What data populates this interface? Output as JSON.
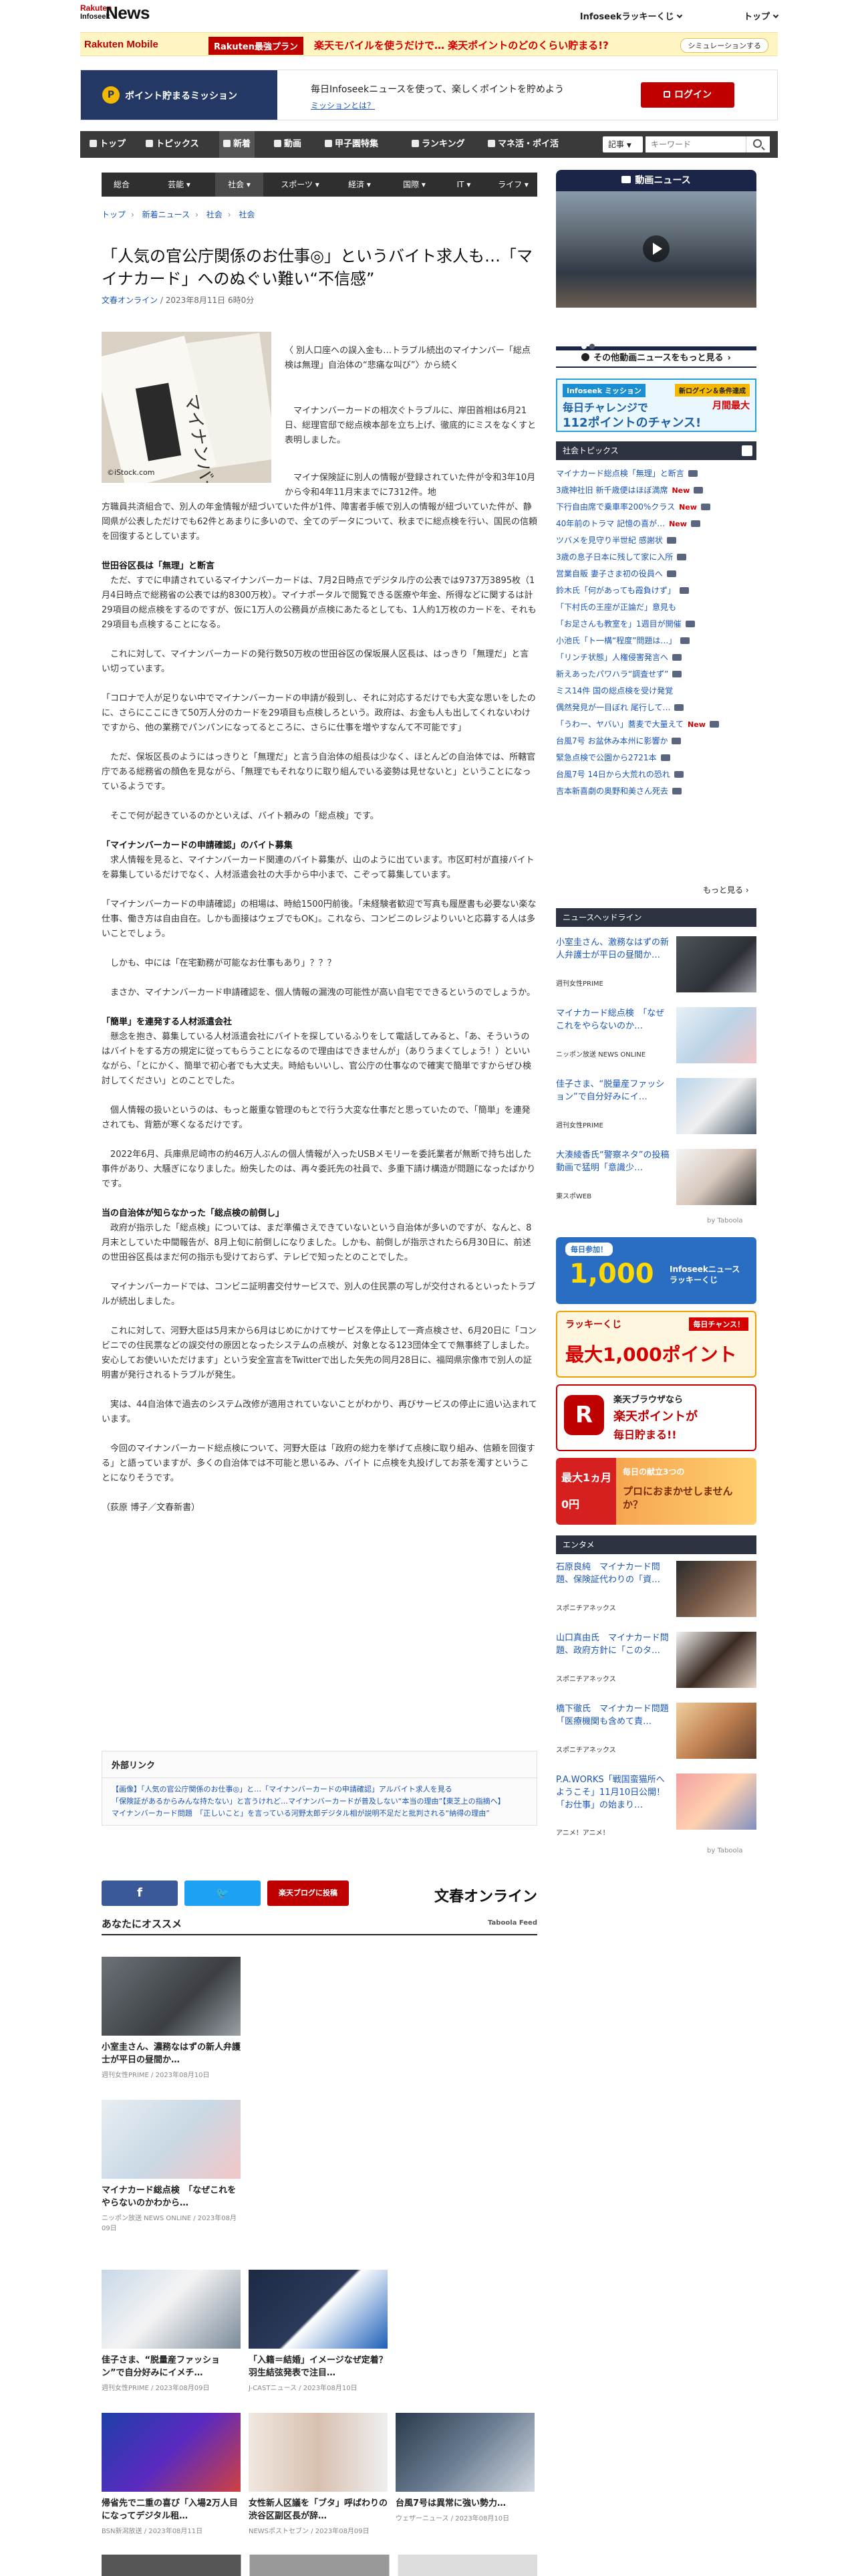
{
  "header": {
    "logo_top": "Rakuten",
    "logo_sub": "Infoseek",
    "logo_main": "News",
    "lucky": "Infoseekラッキーくじ",
    "top": "トップ"
  },
  "promo": {
    "mobile": "Rakuten Mobile",
    "plan": "Rakuten最強プラン",
    "text": "楽天モバイルを使うだけで… 楽天ポイントのどのくらい貯まる!?",
    "button": "シミュレーションする"
  },
  "mission": {
    "left_label": "ポイント貯まるミッション",
    "text": "毎日Infoseekニュースを使って、楽しくポイントを貯めよう",
    "link": "ミッションとは？",
    "login": "ログイン"
  },
  "nav": {
    "items": [
      "トップ",
      "トピックス",
      "新着",
      "動画",
      "甲子園特集",
      "ランキング",
      "マネ活・ポイ活"
    ],
    "search_select": "記事",
    "search_placeholder": "キーワード"
  },
  "subnav": [
    "総合",
    "芸能",
    "社会",
    "スポーツ",
    "経済",
    "国際",
    "IT",
    "ライフ"
  ],
  "breadcrumb": [
    "トップ",
    "新着ニュース",
    "社会",
    "社会"
  ],
  "article": {
    "title": "「人気の官公庁関係のお仕事◎」というバイト求人も…「マイナカード」へのぬぐい難い“不信感”",
    "source": "文春オンライン",
    "date": " / 2023年8月11日 6時0分",
    "photo_credit": "©iStock.com",
    "photo_text": "マイナンバー",
    "lead": "〈 別人口座への誤入金も…トラブル続出のマイナンバー「総点検は無理」自治体の“悲痛な叫び”〉から続く",
    "p1": "マイナンバーカードの相次ぐトラブルに、岸田首相は6月21日、総理官邸で総点検本部を立ち上げ、徹底的にミスをなくすと表明しました。",
    "p2a": "マイナ保険証に別人の情報が登録されていた件が令和3年10月から令和4年11月末までに7312件。地",
    "p2b": "方職員共済組合で、別人の年金情報が紐づいていた件が1件、障害者手帳で別人の情報が紐づいていた件が、静岡県が公表しただけでも62件とあまりに多いので、全てのデータについて、秋までに総点検を行い、国民の信頼を回復するとしています。",
    "h1": "世田谷区長は「無理」と断言",
    "p3": "ただ、すでに申請されているマイナンバーカードは、7月2日時点でデジタル庁の公表では9737万3895枚（1月4日時点で総務省の公表では約8300万枚）。マイナポータルで閲覧できる医療や年金、所得などに関するは計29項目の総点検をするのですが、仮に1万人の公務員が点検にあたるとしても、1人約1万枚のカードを、それも29項目も点検することになる。",
    "p4": "これに対して、マイナンバーカードの発行数50万枚の世田谷区の保坂展人区長は、はっきり「無理だ」と言い切っています。",
    "p5": "「コロナで人が足りない中でマイナンバーカードの申請が殺到し、それに対応するだけでも大変な思いをしたのに、さらにここにきて50万人分のカードを29項目も点検しろという。政府は、お金も人も出してくれないわけですから、他の業務でパンパンになってるところに、さらに仕事を増やすなんて不可能です」",
    "p6": "ただ、保坂区長のようにはっきりと「無理だ」と言う自治体の組長は少なく、ほとんどの自治体では、所轄官庁である総務省の顔色を見ながら、「無理でもそれなりに取り組んでいる姿勢は見せないと」ということになっているようです。",
    "p7": "そこで何が起きているのかといえば、バイト頼みの「総点検」です。",
    "h2": "「マイナンバーカードの申請確認」のバイト募集",
    "p8": "求人情報を見ると、マイナンバーカード関連のバイト募集が、山のように出ています。市区町村が直接バイトを募集しているだけでなく、人材派遣会社の大手から中小まで、こぞって募集しています。",
    "p9": "「マイナンバーカードの申請確認」の相場は、時給1500円前後。「未経験者歓迎で写真も履歴書も必要ない楽な仕事、働き方は自由自在。しかも面接はウェブでもOK」。これなら、コンビニのレジよりいいと応募する人は多いことでしょう。",
    "p10": "しかも、中には「在宅勤務が可能なお仕事もあり」？？？",
    "p11": "まさか、マイナンバーカード申請確認を、個人情報の漏洩の可能性が高い自宅でできるというのでしょうか。",
    "h3": "「簡単」を連発する人材派遣会社",
    "p12": "懸念を抱き、募集している人材派遣会社にバイトを探しているふりをして電話してみると、「あ、そういうのはバイトをする方の規定に従ってもらうことになるので理由はできませんが」（ありうまくてしょう！）といいながら、「とにかく、簡単で初心者でも大丈夫。時給もいいし、官公庁の仕事なので確実で簡単ですからぜひ検討してください」とのことでした。",
    "p13": "個人情報の扱いというのは、もっと厳重な管理のもとで行う大変な仕事だと思っていたので、「簡単」を連発されても、背筋が寒くなるだけです。",
    "p14": "2022年6月、兵庫県尼崎市の約46万人ぶんの個人情報が入ったUSBメモリーを委託業者が無断で持ち出した事件があり、大騒ぎになりました。紛失したのは、再々委託先の社員で、多重下請け構造が問題になったばかりです。",
    "h4": "当の自治体が知らなかった「総点検の前倒し」",
    "p15": "政府が指示した「総点検」については、まだ準備さえできていないという自治体が多いのですが、なんと、8月末としていた中間報告が、8月上旬に前倒しになりました。しかも、前倒しが指示されたら6月30日に、前述の世田谷区長はまだ何の指示も受けておらず、テレビで知ったとのことでした。",
    "p16": "マイナンバーカードでは、コンビニ証明書交付サービスで、別人の住民票の写しが交付されるといったトラブルが続出しました。",
    "p17": "これに対して、河野大臣は5月末から6月はじめにかけてサービスを停止して一斉点検させ、6月20日に「コンビニでの住民票などの誤交付の原因となったシステムの点検が、対象となる123団体全てで無事終了しました。安心してお使いいただけます」という安全宣言をTwitterで出した矢先の同月28日に、福岡県宗像市で別人の証明書が発行されるトラブルが発生。",
    "p18": "実は、44自治体で過去のシステム改修が適用されていないことがわかり、再びサービスの停止に追い込まれています。",
    "p19": "今回のマイナンバーカード総点検について、河野大臣は「政府の総力を挙げて点検に取り組み、信頼を回復する」と語っていますが、多くの自治体では不可能と思いるみ、バイト に点検を丸投げしてお茶を濁すということになりそうです。",
    "byline": "（荻原 博子／文春新書）"
  },
  "external": {
    "heading": "外部リンク",
    "links": [
      "【画像】「人気の官公庁関係のお仕事◎」と…「マイナンバーカードの申請確認」アルバイト求人を見る",
      "「保険証があるからみんな持たない」と言うけれど…マイナンバーカードが普及しない“本当の理由”【東芝上の指摘へ】",
      "マイナンバーカード問題　「正しいこと」を言っている河野太郎デジタル相が説明不足だと批判される“納得の理由”"
    ]
  },
  "share": {
    "rakuten_blog": "楽天ブログに投稿",
    "bunshun": "文春オンライン"
  },
  "recommend": {
    "title": "あなたにオススメ",
    "taboola": "Taboola Feed",
    "cards": [
      {
        "title": "小室圭さん、濃務なはずの新人弁護士が平日の昼間か…",
        "src": "週刊女性PRIME / 2023年08月10日"
      },
      {
        "title": "マイナカード総点検　「なぜこれをやらないのかわから…",
        "src": "ニッポン放送 NEWS ONLINE / 2023年08月09日"
      },
      {
        "title": "佳子さま、“脱量産ファッション”で自分好みにイメチ…",
        "src": "週刊女性PRIME / 2023年08月09日"
      },
      {
        "title": "「入籍＝結婚」イメージなぜ定着？羽生結弦発表で注目…",
        "src": "J-CASTニュース / 2023年08月10日"
      },
      {
        "title": "帰省先で二重の喜び「入場2万人目になってデジタル租…",
        "src": "BSN新潟放送 / 2023年08月11日"
      },
      {
        "title": "女性新人区議を「ブタ」呼ばわりの渋谷区副区長が辞…",
        "src": "NEWSポストセブン / 2023年08月09日"
      },
      {
        "title": "台風7号は異常に強い勢力…",
        "src": "ウェザーニュース / 2023年08月10日"
      }
    ]
  },
  "sidebar": {
    "video_title": "動画ニュース",
    "video_more": "その他動画ニュースをもっと見る",
    "mission_banner": {
      "brand": "Infoseek ミッション",
      "tag": "新ログイン＆条件達成",
      "line1": "毎日チャレンジで",
      "tag2": "月間最大",
      "line2": "112ポイントのチャンス!"
    },
    "topics_title": "社会トピックス",
    "topics": [
      {
        "t": "マイナカード総点検「無理」と断言",
        "new": ""
      },
      {
        "t": "3歳神社旧 新千歳便はほぼ満席",
        "new": "New"
      },
      {
        "t": "下行自由席で乗車率200%クラス",
        "new": "New"
      },
      {
        "t": "40年前のトラマ 記憶の喜が…",
        "new": "New"
      },
      {
        "t": "ツバメを見守り半世紀 感謝状",
        "new": ""
      },
      {
        "t": "3歳の息子日本に残して家に入所",
        "new": ""
      },
      {
        "t": "営業自販 妻子さま初の役員へ",
        "new": ""
      },
      {
        "t": "鈴木氏「何があっても霞負けず」",
        "new": ""
      },
      {
        "t": "「下村氏の王座が正論だ」意見も",
        "new": ""
      },
      {
        "t": "「お足さんも教室を」1週目が開催",
        "new": ""
      },
      {
        "t": "小池氏「ト一構“程度”問題は…」",
        "new": ""
      },
      {
        "t": "「リンチ状態」人権侵害発言へ",
        "new": ""
      },
      {
        "t": "新えあったパワハラ“調査せず”",
        "new": ""
      },
      {
        "t": "ミス14件 国の総点検を受け発覚",
        "new": ""
      },
      {
        "t": "偶然発見が一目ぼれ 尾行して…",
        "new": ""
      },
      {
        "t": "「うわー、ヤバい」蕎麦で大量えて",
        "new": "New"
      },
      {
        "t": "台風7号 お盆休み本州に影響か",
        "new": ""
      },
      {
        "t": "緊急点検で公園から2721本",
        "new": ""
      },
      {
        "t": "台風7号 14日から大荒れの恐れ",
        "new": ""
      },
      {
        "t": "吉本新喜劇の奥野和美さん死去",
        "new": ""
      }
    ],
    "more": "もっと見る",
    "headline_title": "ニュースヘッドライン",
    "headlines": [
      {
        "t": "小室圭さん、激務なはずの新人弁護士が平日の昼間か…",
        "s": "週刊女性PRIME"
      },
      {
        "t": "マイナカード総点検　「なぜこれをやらないのか…",
        "s": "ニッポン放送 NEWS ONLINE"
      },
      {
        "t": "佳子さま、“脱量産ファッション”で自分好みにイ…",
        "s": "週刊女性PRIME"
      },
      {
        "t": "大湊綾香氏“警察ネタ”の投稿動画で猛明「意識少…",
        "s": "東スポWEB"
      }
    ],
    "by_taboola": "by Taboola",
    "banners": [
      {
        "a": "毎日参加！",
        "b": "1,000",
        "c": "Infoseekニュース ラッキーくじ"
      },
      {
        "a": "ラッキーくじ",
        "b": "最大1,000ポイント",
        "c": "毎日チャンス！"
      },
      {
        "a": "楽天ブラウザなら",
        "b": "楽天ポイントが",
        "c": "毎日貯まる!!"
      },
      {
        "a": "最大1ヵ月0円",
        "b": "毎日の献立3つの",
        "c": "プロにおまかせしませんか？"
      }
    ],
    "ent_title": "エンタメ",
    "ent": [
      {
        "t": "石原良純　マイナカード問題、保険証代わりの「資…",
        "s": "スポニチアネックス"
      },
      {
        "t": "山口真由氏　マイナカード問題、政府方針に「このタ…",
        "s": "スポニチアネックス"
      },
      {
        "t": "橋下徹氏　マイナカード問題「医療機関も含めて責…",
        "s": "スポニチアネックス"
      },
      {
        "t": "P.A.WORKS「戦国蛮猫所へようこそ」11月10日公開！「お仕事」の始まり…",
        "s": "アニメ！アニメ！"
      }
    ]
  },
  "colors": {
    "brand_red": "#bf0000",
    "nav_dark": "#3a3a3a",
    "link_blue": "#1a55b8",
    "mission_navy": "#243866"
  }
}
